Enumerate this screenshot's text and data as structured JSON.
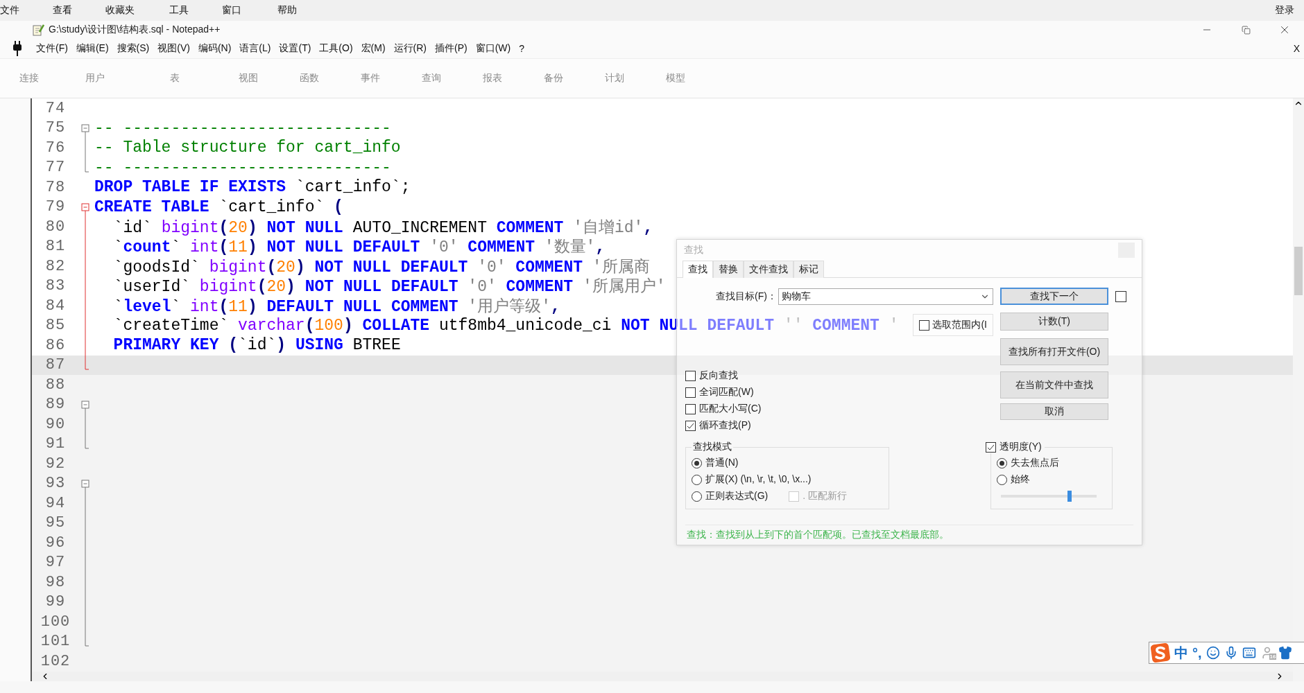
{
  "navicat_menu": {
    "items": [
      "文件",
      "查看",
      "收藏夹",
      "工具",
      "窗口",
      "帮助"
    ],
    "login": "登录"
  },
  "window": {
    "title": "G:\\study\\设计图\\结构表.sql - Notepad++",
    "menu": [
      "文件(F)",
      "编辑(E)",
      "搜索(S)",
      "视图(V)",
      "编码(N)",
      "语言(L)",
      "设置(T)",
      "工具(O)",
      "宏(M)",
      "运行(R)",
      "插件(P)",
      "窗口(W)",
      "?"
    ],
    "close_doc": "X"
  },
  "background_toolbar": [
    "连接",
    "用户",
    "表",
    "视图",
    "函数",
    "事件",
    "查询",
    "报表",
    "备份",
    "计划",
    "模型"
  ],
  "editor": {
    "lines": [
      {
        "number": "74",
        "selected": false
      },
      {
        "number": "75",
        "selected": false,
        "fold": {
          "kind": "start",
          "active": false
        },
        "tokens": [
          {
            "kind": "cm",
            "text": "-- ----------------------------"
          }
        ]
      },
      {
        "number": "76",
        "selected": false,
        "fold": {
          "kind": "body",
          "active": false
        },
        "tokens": [
          {
            "kind": "cm",
            "text": "-- Table structure for cart_info"
          }
        ]
      },
      {
        "number": "77",
        "selected": false,
        "fold": {
          "kind": "end",
          "active": false
        },
        "tokens": [
          {
            "kind": "cm",
            "text": "-- ----------------------------"
          }
        ]
      },
      {
        "number": "78",
        "selected": false,
        "tokens": [
          {
            "kind": "kw",
            "text": "DROP TABLE IF EXISTS"
          },
          {
            "kind": "tx",
            "text": " `cart_info`;"
          }
        ]
      },
      {
        "number": "79",
        "selected": false,
        "fold": {
          "kind": "start",
          "active": true
        },
        "tokens": [
          {
            "kind": "kw",
            "text": "CREATE TABLE"
          },
          {
            "kind": "tx",
            "text": " `cart_info` "
          },
          {
            "kind": "op",
            "text": "("
          }
        ]
      },
      {
        "number": "80",
        "selected": false,
        "fold": {
          "kind": "body",
          "active": true
        },
        "tokens": [
          {
            "kind": "tx",
            "text": "  `id` "
          },
          {
            "kind": "type",
            "text": "bigint"
          },
          {
            "kind": "op",
            "text": "("
          },
          {
            "kind": "num",
            "text": "20"
          },
          {
            "kind": "op",
            "text": ")"
          },
          {
            "kind": "kw",
            "text": " NOT NULL"
          },
          {
            "kind": "tx",
            "text": " AUTO_INCREMENT "
          },
          {
            "kind": "kw",
            "text": "COMMENT"
          },
          {
            "kind": "str",
            "text": " '自增id'"
          },
          {
            "kind": "op",
            "text": ","
          }
        ]
      },
      {
        "number": "81",
        "selected": false,
        "fold": {
          "kind": "body",
          "active": true
        },
        "tokens": [
          {
            "kind": "tx",
            "text": "  `"
          },
          {
            "kind": "kw",
            "text": "count"
          },
          {
            "kind": "tx",
            "text": "` "
          },
          {
            "kind": "type",
            "text": "int"
          },
          {
            "kind": "op",
            "text": "("
          },
          {
            "kind": "num",
            "text": "11"
          },
          {
            "kind": "op",
            "text": ")"
          },
          {
            "kind": "kw",
            "text": " NOT NULL DEFAULT"
          },
          {
            "kind": "str",
            "text": " '0'"
          },
          {
            "kind": "kw",
            "text": " COMMENT"
          },
          {
            "kind": "str",
            "text": " '数量'"
          },
          {
            "kind": "op",
            "text": ","
          }
        ]
      },
      {
        "number": "82",
        "selected": false,
        "fold": {
          "kind": "body",
          "active": true
        },
        "tokens": [
          {
            "kind": "tx",
            "text": "  `goodsId` "
          },
          {
            "kind": "type",
            "text": "bigint"
          },
          {
            "kind": "op",
            "text": "("
          },
          {
            "kind": "num",
            "text": "20"
          },
          {
            "kind": "op",
            "text": ")"
          },
          {
            "kind": "kw",
            "text": " NOT NULL DEFAULT"
          },
          {
            "kind": "str",
            "text": " '0'"
          },
          {
            "kind": "kw",
            "text": " COMMENT"
          },
          {
            "kind": "str",
            "text": " '所属商"
          }
        ]
      },
      {
        "number": "83",
        "selected": false,
        "fold": {
          "kind": "body",
          "active": true
        },
        "tokens": [
          {
            "kind": "tx",
            "text": "  `userId` "
          },
          {
            "kind": "type",
            "text": "bigint"
          },
          {
            "kind": "op",
            "text": "("
          },
          {
            "kind": "num",
            "text": "20"
          },
          {
            "kind": "op",
            "text": ")"
          },
          {
            "kind": "kw",
            "text": " NOT NULL DEFAULT"
          },
          {
            "kind": "str",
            "text": " '0'"
          },
          {
            "kind": "kw",
            "text": " COMMENT"
          },
          {
            "kind": "str",
            "text": " '所属用户'"
          }
        ]
      },
      {
        "number": "84",
        "selected": false,
        "fold": {
          "kind": "body",
          "active": true
        },
        "tokens": [
          {
            "kind": "tx",
            "text": "  `"
          },
          {
            "kind": "kw",
            "text": "level"
          },
          {
            "kind": "tx",
            "text": "` "
          },
          {
            "kind": "type",
            "text": "int"
          },
          {
            "kind": "op",
            "text": "("
          },
          {
            "kind": "num",
            "text": "11"
          },
          {
            "kind": "op",
            "text": ")"
          },
          {
            "kind": "kw",
            "text": " DEFAULT NULL COMMENT"
          },
          {
            "kind": "str",
            "text": " '用户等级'"
          },
          {
            "kind": "op",
            "text": ","
          }
        ]
      },
      {
        "number": "85",
        "selected": false,
        "fold": {
          "kind": "body",
          "active": true
        },
        "tokens": [
          {
            "kind": "tx",
            "text": "  `createTime` "
          },
          {
            "kind": "type",
            "text": "varchar"
          },
          {
            "kind": "op",
            "text": "("
          },
          {
            "kind": "num",
            "text": "100"
          },
          {
            "kind": "op",
            "text": ")"
          },
          {
            "kind": "kw",
            "text": " COLLATE"
          },
          {
            "kind": "tx",
            "text": " utf8mb4_unicode_ci "
          },
          {
            "kind": "kw",
            "text": "NOT NULL DEFAULT"
          },
          {
            "kind": "str",
            "text": " ''"
          },
          {
            "kind": "kw",
            "text": " COMMENT"
          },
          {
            "kind": "str",
            "text": " '"
          }
        ]
      },
      {
        "number": "86",
        "selected": false,
        "fold": {
          "kind": "body",
          "active": true
        },
        "tokens": [
          {
            "kind": "kw",
            "text": "  PRIMARY KEY"
          },
          {
            "kind": "op",
            "text": " ("
          },
          {
            "kind": "tx",
            "text": "`id`"
          },
          {
            "kind": "op",
            "text": ")"
          },
          {
            "kind": "kw",
            "text": " USING"
          },
          {
            "kind": "tx",
            "text": " BTREE"
          }
        ]
      },
      {
        "number": "87",
        "selected": true,
        "fold": {
          "kind": "end",
          "active": true
        }
      },
      {
        "number": "88",
        "selected": false
      },
      {
        "number": "89",
        "selected": false,
        "fold": {
          "kind": "start",
          "active": false
        }
      },
      {
        "number": "90",
        "selected": false,
        "fold": {
          "kind": "body",
          "active": false
        }
      },
      {
        "number": "91",
        "selected": false,
        "fold": {
          "kind": "end",
          "active": false
        }
      },
      {
        "number": "92",
        "selected": false
      },
      {
        "number": "93",
        "selected": false,
        "fold": {
          "kind": "start",
          "active": false
        }
      },
      {
        "number": "94",
        "selected": false,
        "fold": {
          "kind": "body",
          "active": false
        }
      },
      {
        "number": "95",
        "selected": false,
        "fold": {
          "kind": "body",
          "active": false
        }
      },
      {
        "number": "96",
        "selected": false,
        "fold": {
          "kind": "body",
          "active": false
        }
      },
      {
        "number": "97",
        "selected": false,
        "fold": {
          "kind": "body",
          "active": false
        }
      },
      {
        "number": "98",
        "selected": false,
        "fold": {
          "kind": "body",
          "active": false
        }
      },
      {
        "number": "99",
        "selected": false,
        "fold": {
          "kind": "body",
          "active": false
        }
      },
      {
        "number": "100",
        "selected": false,
        "fold": {
          "kind": "body",
          "active": false
        }
      },
      {
        "number": "101",
        "selected": false,
        "fold": {
          "kind": "end",
          "active": false
        }
      },
      {
        "number": "102",
        "selected": false
      }
    ]
  },
  "find_dialog": {
    "title": "查找",
    "tabs": [
      {
        "label": "查找",
        "selected": true
      },
      {
        "label": "替换",
        "selected": false
      },
      {
        "label": "文件查找",
        "selected": false
      },
      {
        "label": "标记",
        "selected": false
      }
    ],
    "target_label": "查找目标(F)：",
    "target_value": "购物车",
    "buttons": [
      {
        "label": "查找下一个",
        "default": true
      },
      {
        "label": "计数(T)",
        "default": false
      },
      {
        "label": "查找所有打开文件(O)",
        "default": false
      },
      {
        "label": "在当前文件中查找",
        "default": false
      },
      {
        "label": "取消",
        "default": false
      }
    ],
    "side_checkbox": {
      "checked": false
    },
    "in_selection": {
      "label": "选取范围内(I",
      "checked": false
    },
    "options": [
      {
        "label": "反向查找",
        "checked": false
      },
      {
        "label": "全词匹配(W)",
        "checked": false
      },
      {
        "label": "匹配大小写(C)",
        "checked": false
      },
      {
        "label": "循环查找(P)",
        "checked": true
      }
    ],
    "mode": {
      "title": "查找模式",
      "options": [
        {
          "label": "普通(N)",
          "selected": true
        },
        {
          "label": "扩展(X) (\\n, \\r, \\t, \\0, \\x...)",
          "selected": false
        },
        {
          "label": "正则表达式(G)",
          "selected": false
        }
      ],
      "dot_newline": {
        "label": ". 匹配新行",
        "checked": false,
        "disabled": true
      }
    },
    "transparency": {
      "label": "透明度(Y)",
      "checked": true,
      "options": [
        {
          "label": "失去焦点后",
          "selected": true
        },
        {
          "label": "始终",
          "selected": false
        }
      ],
      "level": 0.72
    },
    "status": "查找：查找到从上到下的首个匹配项。已查找至文档最底部。"
  },
  "ime_bar": {
    "mode": "中",
    "punct": "°,",
    "badge": "16"
  }
}
